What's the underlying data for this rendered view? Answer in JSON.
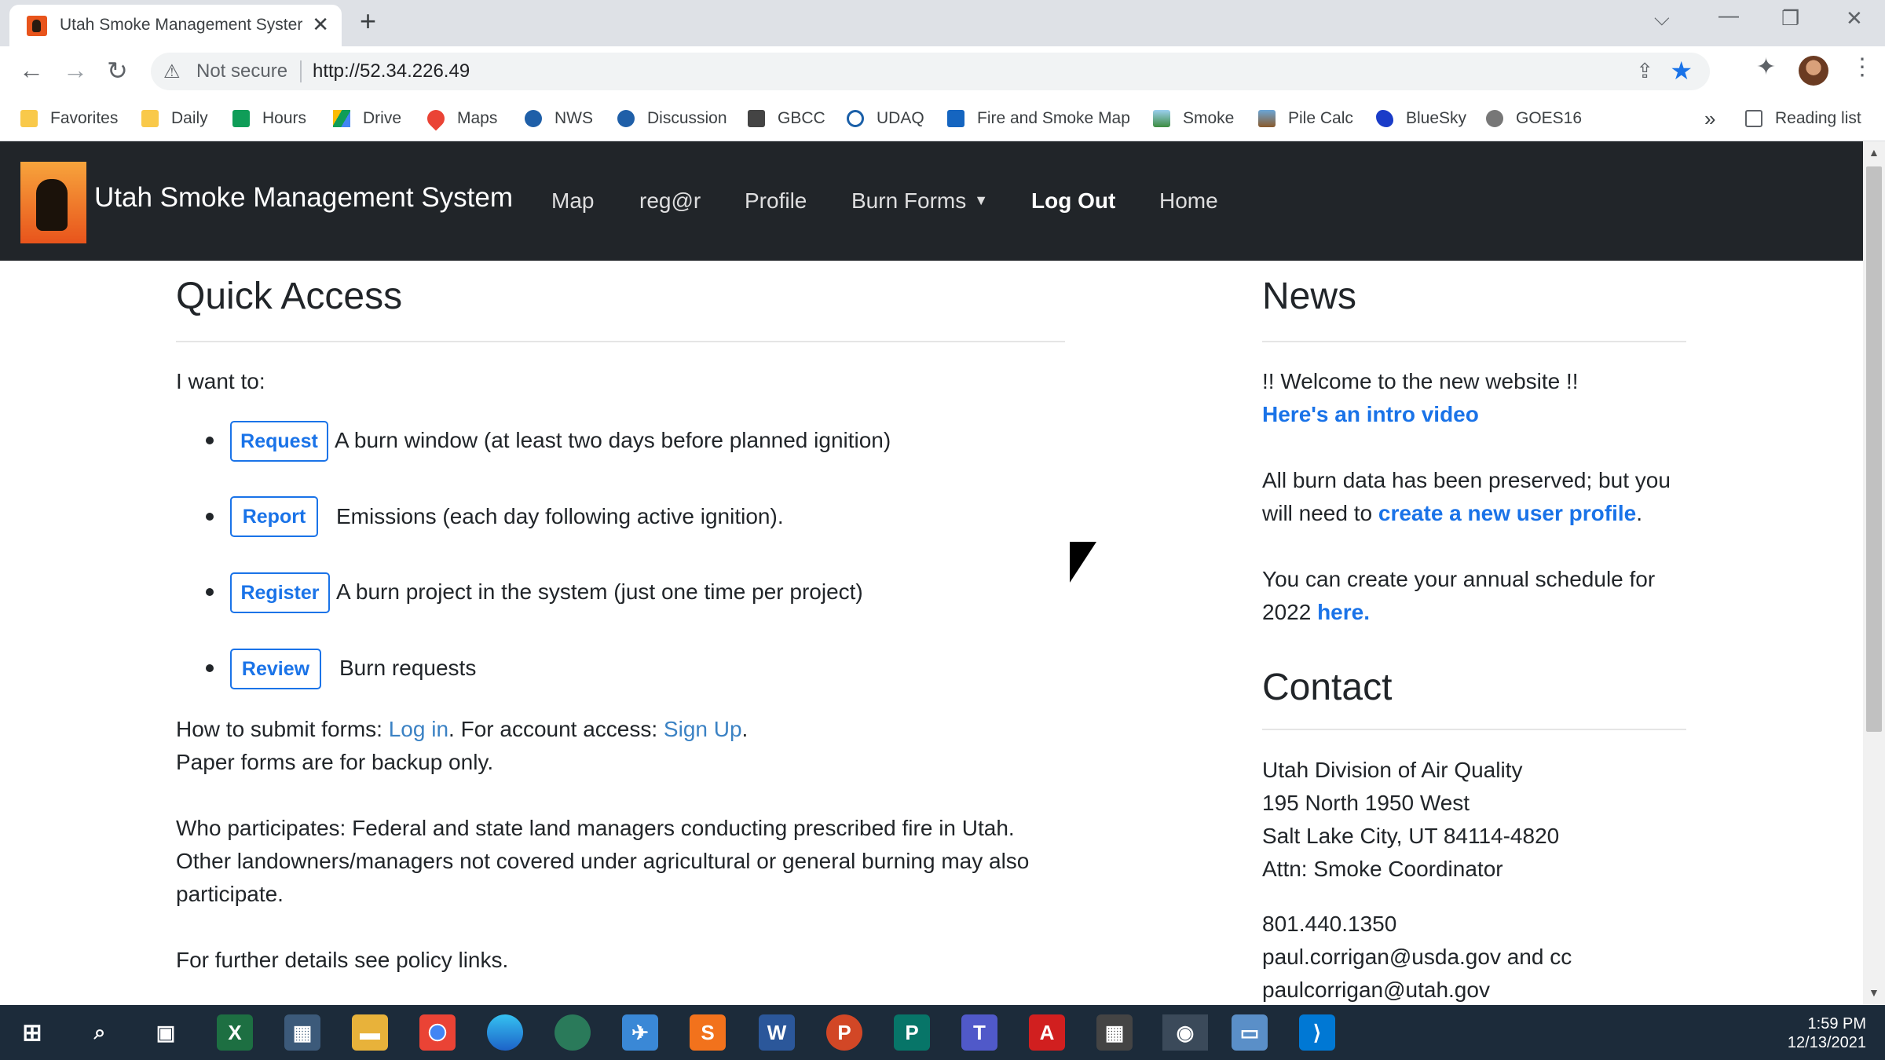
{
  "browser": {
    "tab_title": "Utah Smoke Management Syster",
    "security_label": "Not secure",
    "url": "http://52.34.226.49",
    "bookmarks": [
      "Favorites",
      "Daily",
      "Hours",
      "Drive",
      "Maps",
      "NWS",
      "Discussion",
      "GBCC",
      "UDAQ",
      "Fire and Smoke Map",
      "Smoke",
      "Pile Calc",
      "BlueSky",
      "GOES16"
    ],
    "overflow": "»",
    "reading_list": "Reading list"
  },
  "nav": {
    "brand": "Utah Smoke Management System",
    "links": [
      "Map",
      "reg@r",
      "Profile",
      "Burn Forms",
      "Log Out",
      "Home"
    ]
  },
  "quick": {
    "title": "Quick Access",
    "intro": "I want to:",
    "items": [
      {
        "button": "Request",
        "text": "A burn window (at least two days before planned ignition)"
      },
      {
        "button": "Report",
        "text": "Emissions (each day following active ignition)."
      },
      {
        "button": "Register",
        "text": "A burn project in the system (just one time per project)"
      },
      {
        "button": "Review",
        "text": "Burn requests"
      }
    ],
    "submit_prefix": "How to submit forms: ",
    "login": "Log in",
    "account_prefix": ". For account access: ",
    "signup": "Sign Up",
    "period": ".",
    "paper": "Paper forms are for backup only.",
    "who1": "Who participates: Federal and state land managers conducting prescribed fire in Utah.",
    "who2": "Other landowners/managers not covered under agricultural or general burning may also",
    "who3": "participate.",
    "further": "For further details see policy links."
  },
  "news": {
    "title": "News",
    "welcome": "!! Welcome to the new website !!",
    "intro_video": "Here's an intro video",
    "preserved1": "All burn data has been preserved; but you",
    "preserved2": "will need to ",
    "create_profile": "create a new user profile",
    "period": ".",
    "schedule1": "You can create your annual schedule for",
    "schedule2": "2022 ",
    "here": "here."
  },
  "contact": {
    "title": "Contact",
    "org": "Utah Division of Air Quality",
    "street": "195 North 1950 West",
    "city": "Salt Lake City, UT 84114-4820",
    "attn": "Attn: Smoke Coordinator",
    "phone": "801.440.1350",
    "email1": "paul.corrigan@usda.gov and cc",
    "email2": "paulcorrigan@utah.gov"
  },
  "taskbar": {
    "time": "1:59 PM",
    "date": "12/13/2021"
  },
  "colors": {
    "navbar": "#212529",
    "link": "#1a73e8",
    "taskbar": "#1c2b3a"
  }
}
